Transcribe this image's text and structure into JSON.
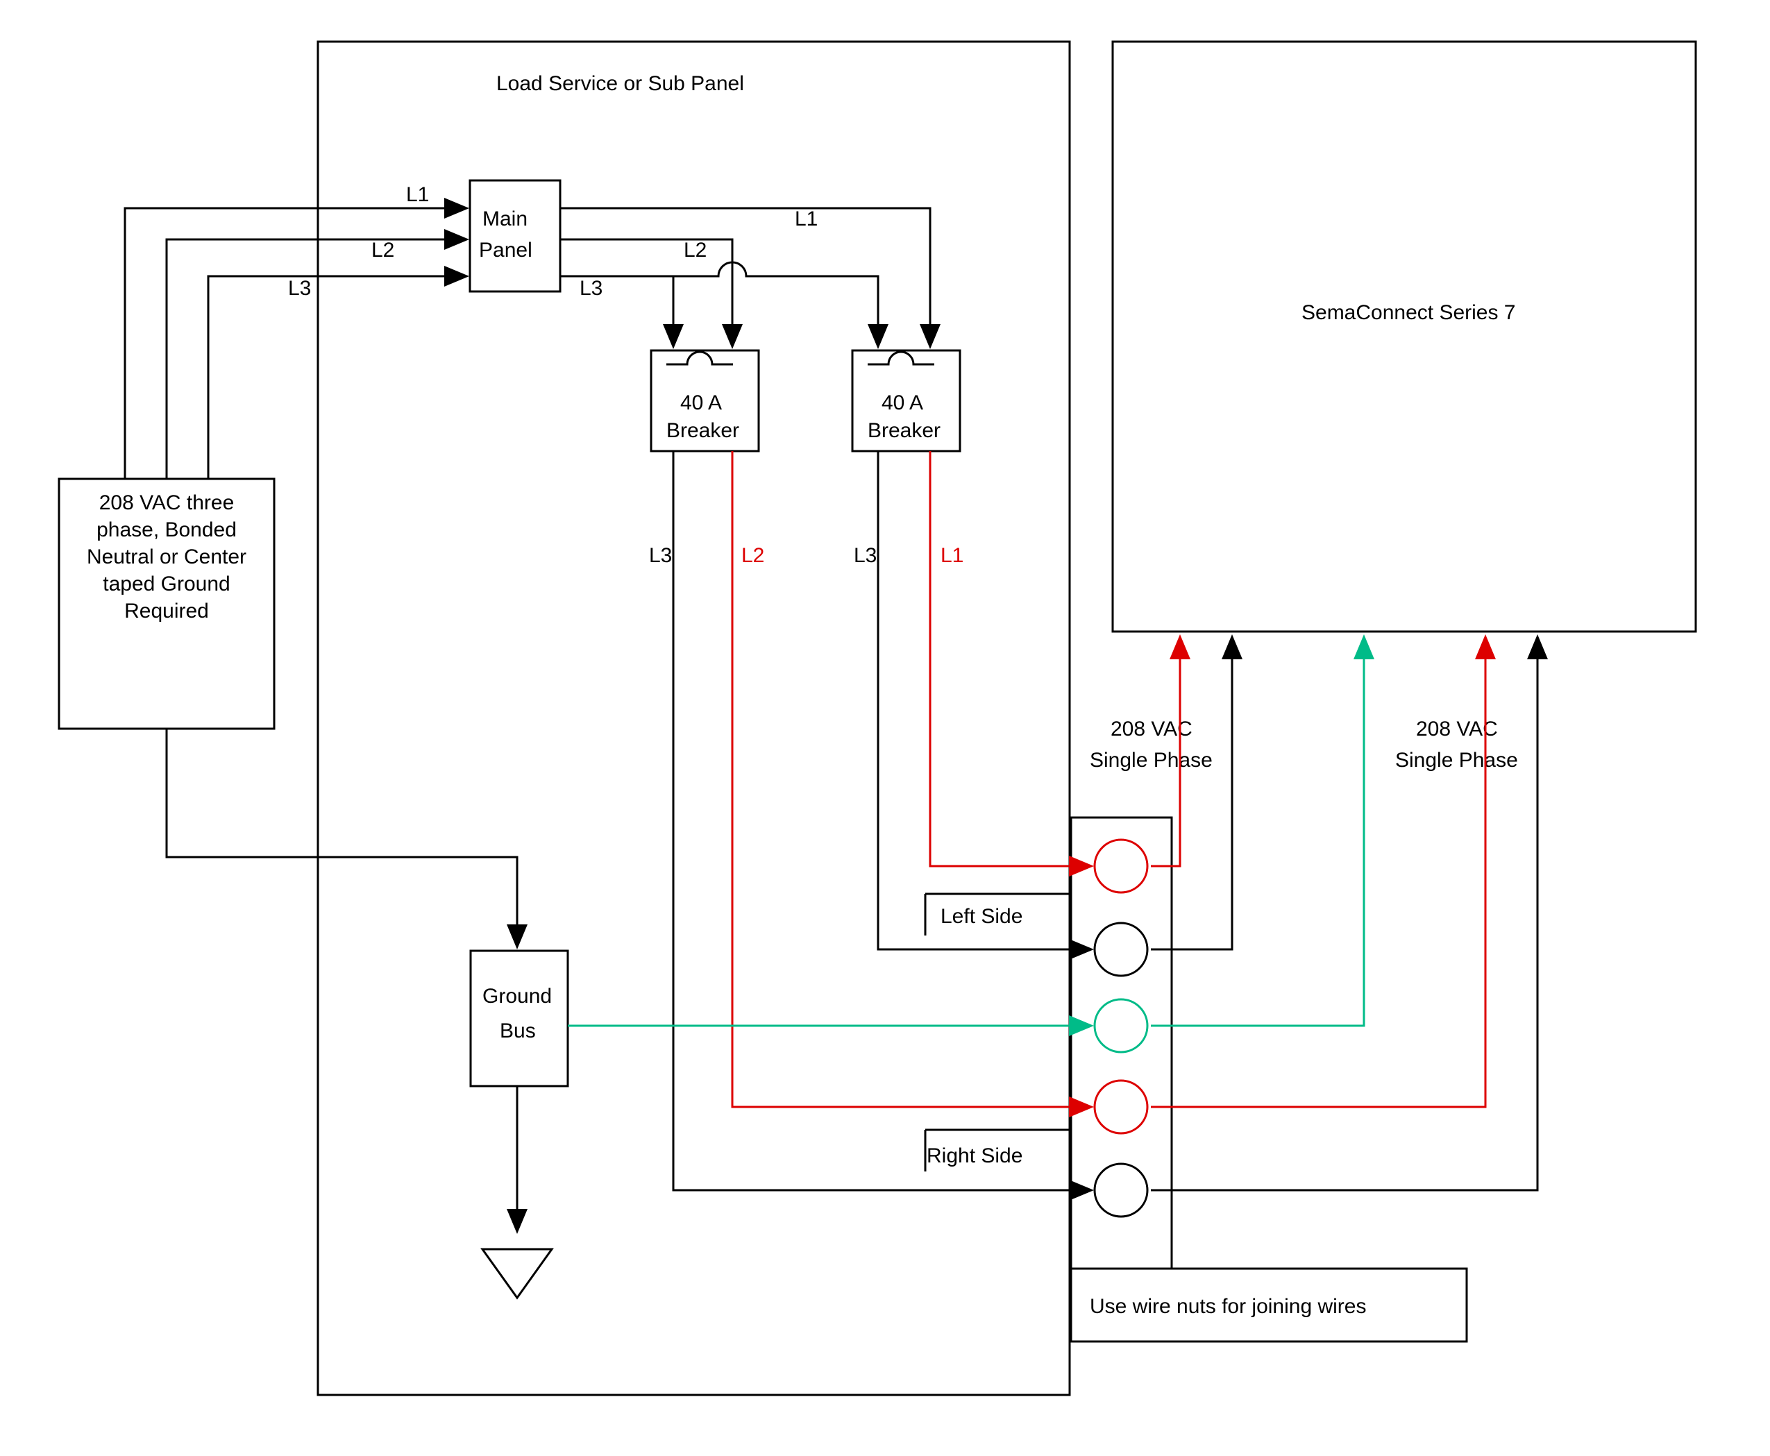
{
  "panel_title": "Load Service or Sub Panel",
  "source_label": "208 VAC three phase, Bonded Neutral or Center taped Ground Required",
  "main_panel": "Main Panel",
  "breaker1": {
    "amps": "40 A",
    "label": "Breaker"
  },
  "breaker2": {
    "amps": "40 A",
    "label": "Breaker"
  },
  "ground_bus": "Ground Bus",
  "left_side": "Left Side",
  "right_side": "Right Side",
  "sema_label": "SemaConnect Series 7",
  "phase_label_1": "208 VAC Single Phase",
  "phase_label_2": "208 VAC Single Phase",
  "wire_nuts": "Use wire nuts for joining wires",
  "lines": {
    "L1": "L1",
    "L2": "L2",
    "L3": "L3"
  }
}
